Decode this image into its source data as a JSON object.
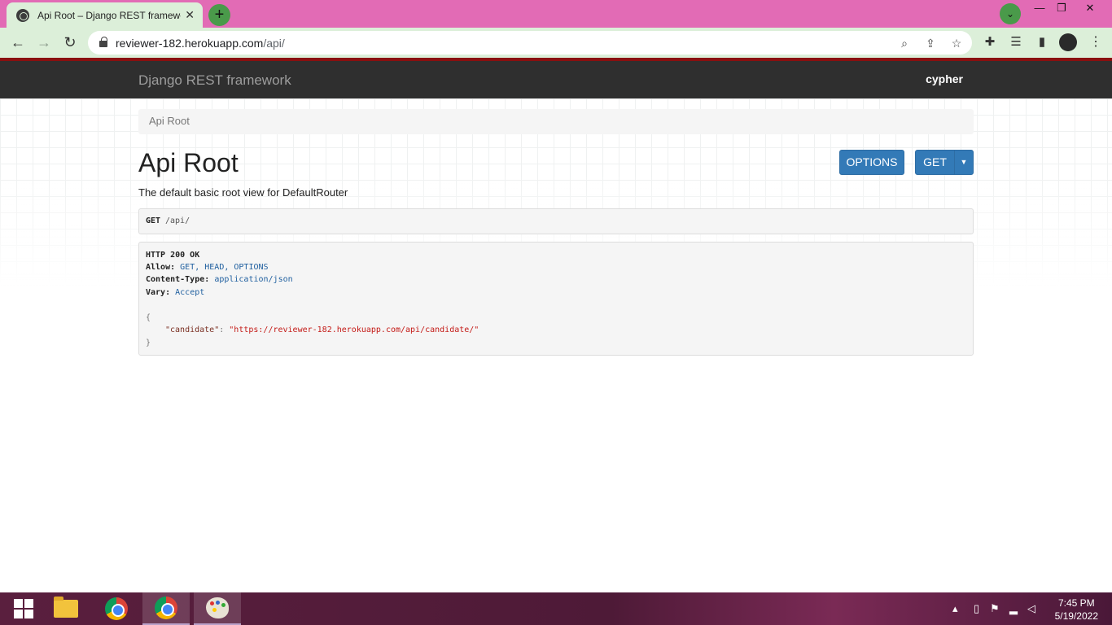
{
  "browser": {
    "tab_title": "Api Root – Django REST framework",
    "tab_close": "✕",
    "new_tab": "+",
    "url_host": "reviewer-182.herokuapp.com",
    "url_path": "/api/",
    "window_controls": {
      "minimize": "—",
      "maximize": "❐",
      "close": "✕"
    }
  },
  "navbar": {
    "brand": "Django REST framework",
    "user": "cypher"
  },
  "breadcrumb": {
    "items": [
      "Api Root"
    ]
  },
  "page": {
    "title": "Api Root",
    "description": "The default basic root view for DefaultRouter"
  },
  "buttons": {
    "options": "OPTIONS",
    "get": "GET",
    "caret": "▼"
  },
  "request": {
    "method": "GET",
    "path": "/api/"
  },
  "response": {
    "status": "HTTP 200 OK",
    "headers": [
      {
        "name": "Allow:",
        "value": "GET, HEAD, OPTIONS"
      },
      {
        "name": "Content-Type:",
        "value": "application/json"
      },
      {
        "name": "Vary:",
        "value": "Accept"
      }
    ],
    "open_brace": "{",
    "close_brace": "}",
    "body_key": "\"candidate\"",
    "body_colon": ": ",
    "body_value": "\"https://reviewer-182.herokuapp.com/api/candidate/\""
  },
  "taskbar": {
    "time": "7:45 PM",
    "date": "5/19/2022"
  },
  "colors": {
    "tabstrip": "#e26bb5",
    "toolbar": "#dcefd9",
    "navbar": "#2f2f2f",
    "primary_button": "#337ab7"
  }
}
